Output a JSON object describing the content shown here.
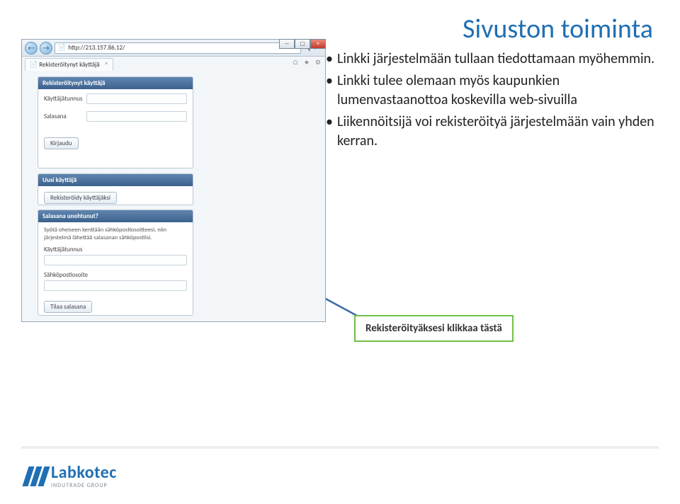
{
  "slide": {
    "title": "Sivuston toiminta"
  },
  "browser": {
    "url": "http://213.157.86.12/",
    "tab_title": "Rekisteröitynyt käyttäjä",
    "win": {
      "min": "—",
      "max": "▢",
      "close": "×"
    },
    "nav_back": "←",
    "nav_fwd": "→",
    "addr_icons": {
      "search": "🔍",
      "refresh": "↻",
      "stop": "×"
    },
    "tool_icons": {
      "home": "⌂",
      "star": "★",
      "gear": "⚙"
    },
    "login_panel": {
      "header": "Rekisteröitynyt käyttäjä",
      "username_label": "Käyttäjätunnus",
      "password_label": "Salasana",
      "login_button": "Kirjaudu"
    },
    "newuser_panel": {
      "header": "Uusi käyttäjä",
      "register_button": "Rekisteröidy käyttäjäksi"
    },
    "forgot_panel": {
      "header": "Salasana unohtunut?",
      "help": "Syötä oheiseen kenttään sähköpostiosoitteesi, niin järjestelmä lähettää salasanan sähköpostiisi.",
      "username_label": "Käyttäjätunnus",
      "email_label": "Sähköpostiosoite",
      "order_button": "Tilaa salasana"
    }
  },
  "bullets": {
    "items": [
      "Linkki järjestelmään tullaan tiedottamaan myöhemmin.",
      "Linkki tulee olemaan myös kaupunkien lumenvastaanottoa koskevilla web-sivuilla",
      "Liikennöitsijä voi rekisteröityä järjestelmään vain yhden kerran."
    ]
  },
  "callout": {
    "text": "Rekisteröityäksesi klikkaa tästä"
  },
  "footer": {
    "logo_name": "Labkotec",
    "logo_sub": "INDUTRADE GROUP"
  }
}
